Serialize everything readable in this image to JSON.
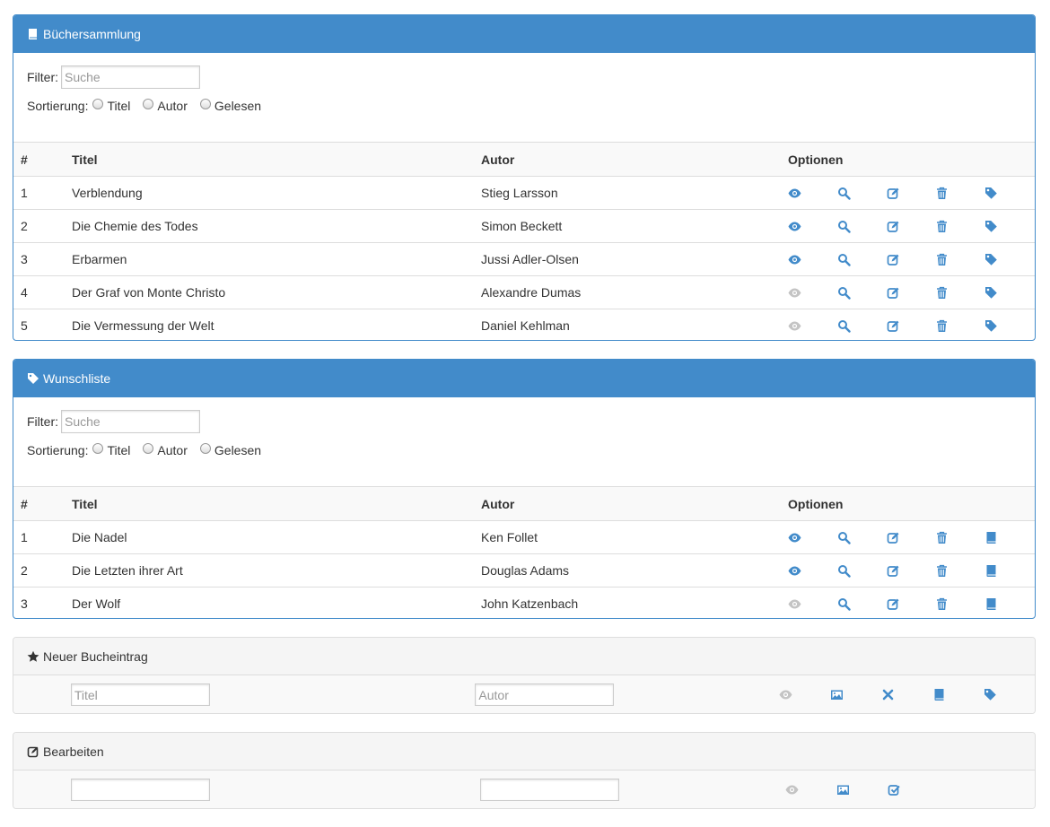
{
  "collection": {
    "title": "Büchersammlung",
    "filter_label": "Filter:",
    "filter_placeholder": "Suche",
    "sort_label": "Sortierung:",
    "sort_options": [
      "Titel",
      "Autor",
      "Gelesen"
    ],
    "columns": [
      "#",
      "Titel",
      "Autor",
      "Optionen"
    ],
    "rows": [
      {
        "num": "1",
        "title": "Verblendung",
        "author": "Stieg Larsson",
        "read": true
      },
      {
        "num": "2",
        "title": "Die Chemie des Todes",
        "author": "Simon Beckett",
        "read": true
      },
      {
        "num": "3",
        "title": "Erbarmen",
        "author": "Jussi Adler-Olsen",
        "read": true
      },
      {
        "num": "4",
        "title": "Der Graf von Monte Christo",
        "author": "Alexandre Dumas",
        "read": false
      },
      {
        "num": "5",
        "title": "Die Vermessung der Welt",
        "author": "Daniel Kehlman",
        "read": false
      }
    ]
  },
  "wishlist": {
    "title": "Wunschliste",
    "filter_label": "Filter:",
    "filter_placeholder": "Suche",
    "sort_label": "Sortierung:",
    "sort_options": [
      "Titel",
      "Autor",
      "Gelesen"
    ],
    "columns": [
      "#",
      "Titel",
      "Autor",
      "Optionen"
    ],
    "rows": [
      {
        "num": "1",
        "title": "Die Nadel",
        "author": "Ken Follet",
        "read": true
      },
      {
        "num": "2",
        "title": "Die Letzten ihrer Art",
        "author": "Douglas Adams",
        "read": true
      },
      {
        "num": "3",
        "title": "Der Wolf",
        "author": "John Katzenbach",
        "read": false
      }
    ]
  },
  "new_entry": {
    "title": "Neuer Bucheintrag",
    "title_placeholder": "Titel",
    "author_placeholder": "Autor"
  },
  "edit": {
    "title": "Bearbeiten",
    "title_value": "",
    "author_value": ""
  },
  "colors": {
    "primary": "#428bca",
    "inactive_icon": "#c4c4c4"
  },
  "icons": {
    "collection_row": [
      "eye-icon",
      "search-icon",
      "edit-icon",
      "trash-icon",
      "tag-icon"
    ],
    "wishlist_row": [
      "eye-icon",
      "search-icon",
      "edit-icon",
      "trash-icon",
      "book-icon"
    ],
    "new_entry": [
      "eye-icon",
      "picture-icon",
      "remove-icon",
      "book-icon",
      "tag-icon"
    ],
    "edit": [
      "eye-icon",
      "picture-icon",
      "check-icon"
    ]
  }
}
